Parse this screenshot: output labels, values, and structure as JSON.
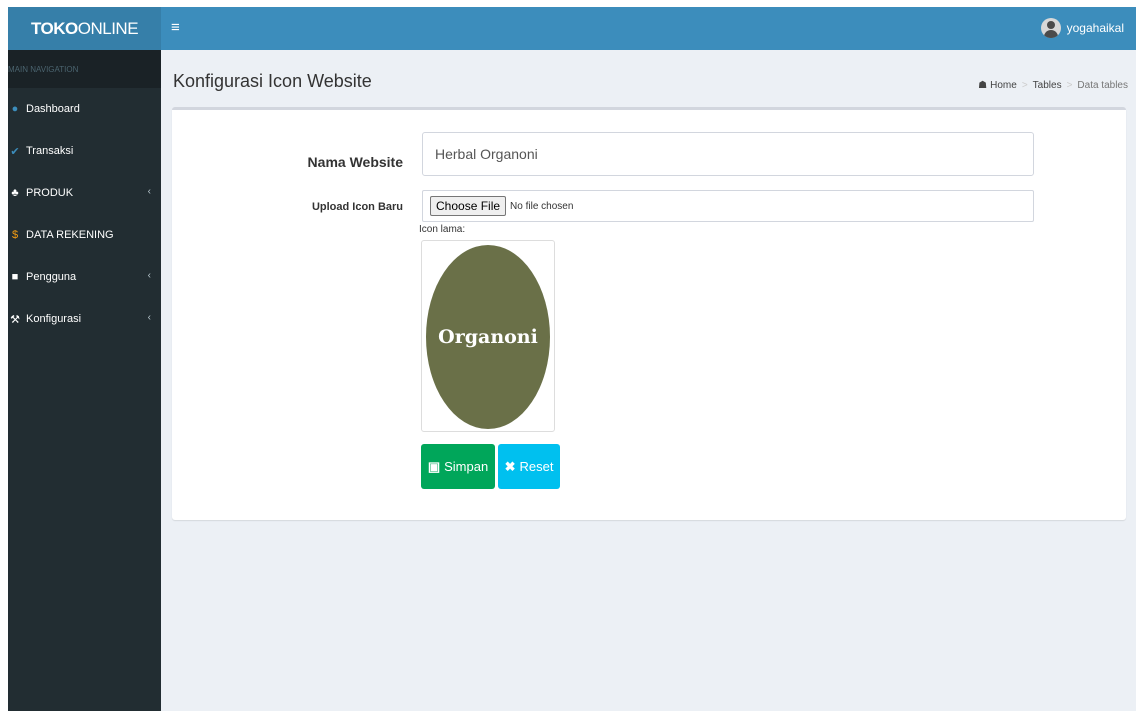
{
  "brand": {
    "bold": "TOKO",
    "normal": "ONLINE"
  },
  "topbar": {
    "username": "yogahaikal"
  },
  "sidebar": {
    "header": "MAIN NAVIGATION",
    "items": [
      {
        "label": "Dashboard",
        "icon": "dashboard-icon"
      },
      {
        "label": "Transaksi",
        "icon": "check-icon"
      },
      {
        "label": "PRODUK",
        "icon": "sitemap-icon",
        "has_children": true
      },
      {
        "label": "DATA REKENING",
        "icon": "dollar-icon"
      },
      {
        "label": "Pengguna",
        "icon": "lock-icon",
        "has_children": true
      },
      {
        "label": "Konfigurasi",
        "icon": "wrench-icon",
        "has_children": true
      }
    ]
  },
  "page": {
    "title": "Konfigurasi Icon Website",
    "breadcrumb": [
      "Home",
      "Tables",
      "Data tables"
    ]
  },
  "form": {
    "nama_label": "Nama Website",
    "nama_value": "Herbal Organoni",
    "upload_label": "Upload Icon Baru",
    "choose_file": "Choose File",
    "no_file": "No file chosen",
    "icon_lama_label": "Icon lama:",
    "icon_text": "Organoni",
    "save_label": "Simpan",
    "reset_label": "Reset"
  },
  "colors": {
    "header": "#3c8dbc",
    "logo": "#367fa9",
    "sidebar": "#222d32",
    "save": "#00a65a",
    "reset": "#00c0ef",
    "icon_bg": "#6a7048"
  }
}
